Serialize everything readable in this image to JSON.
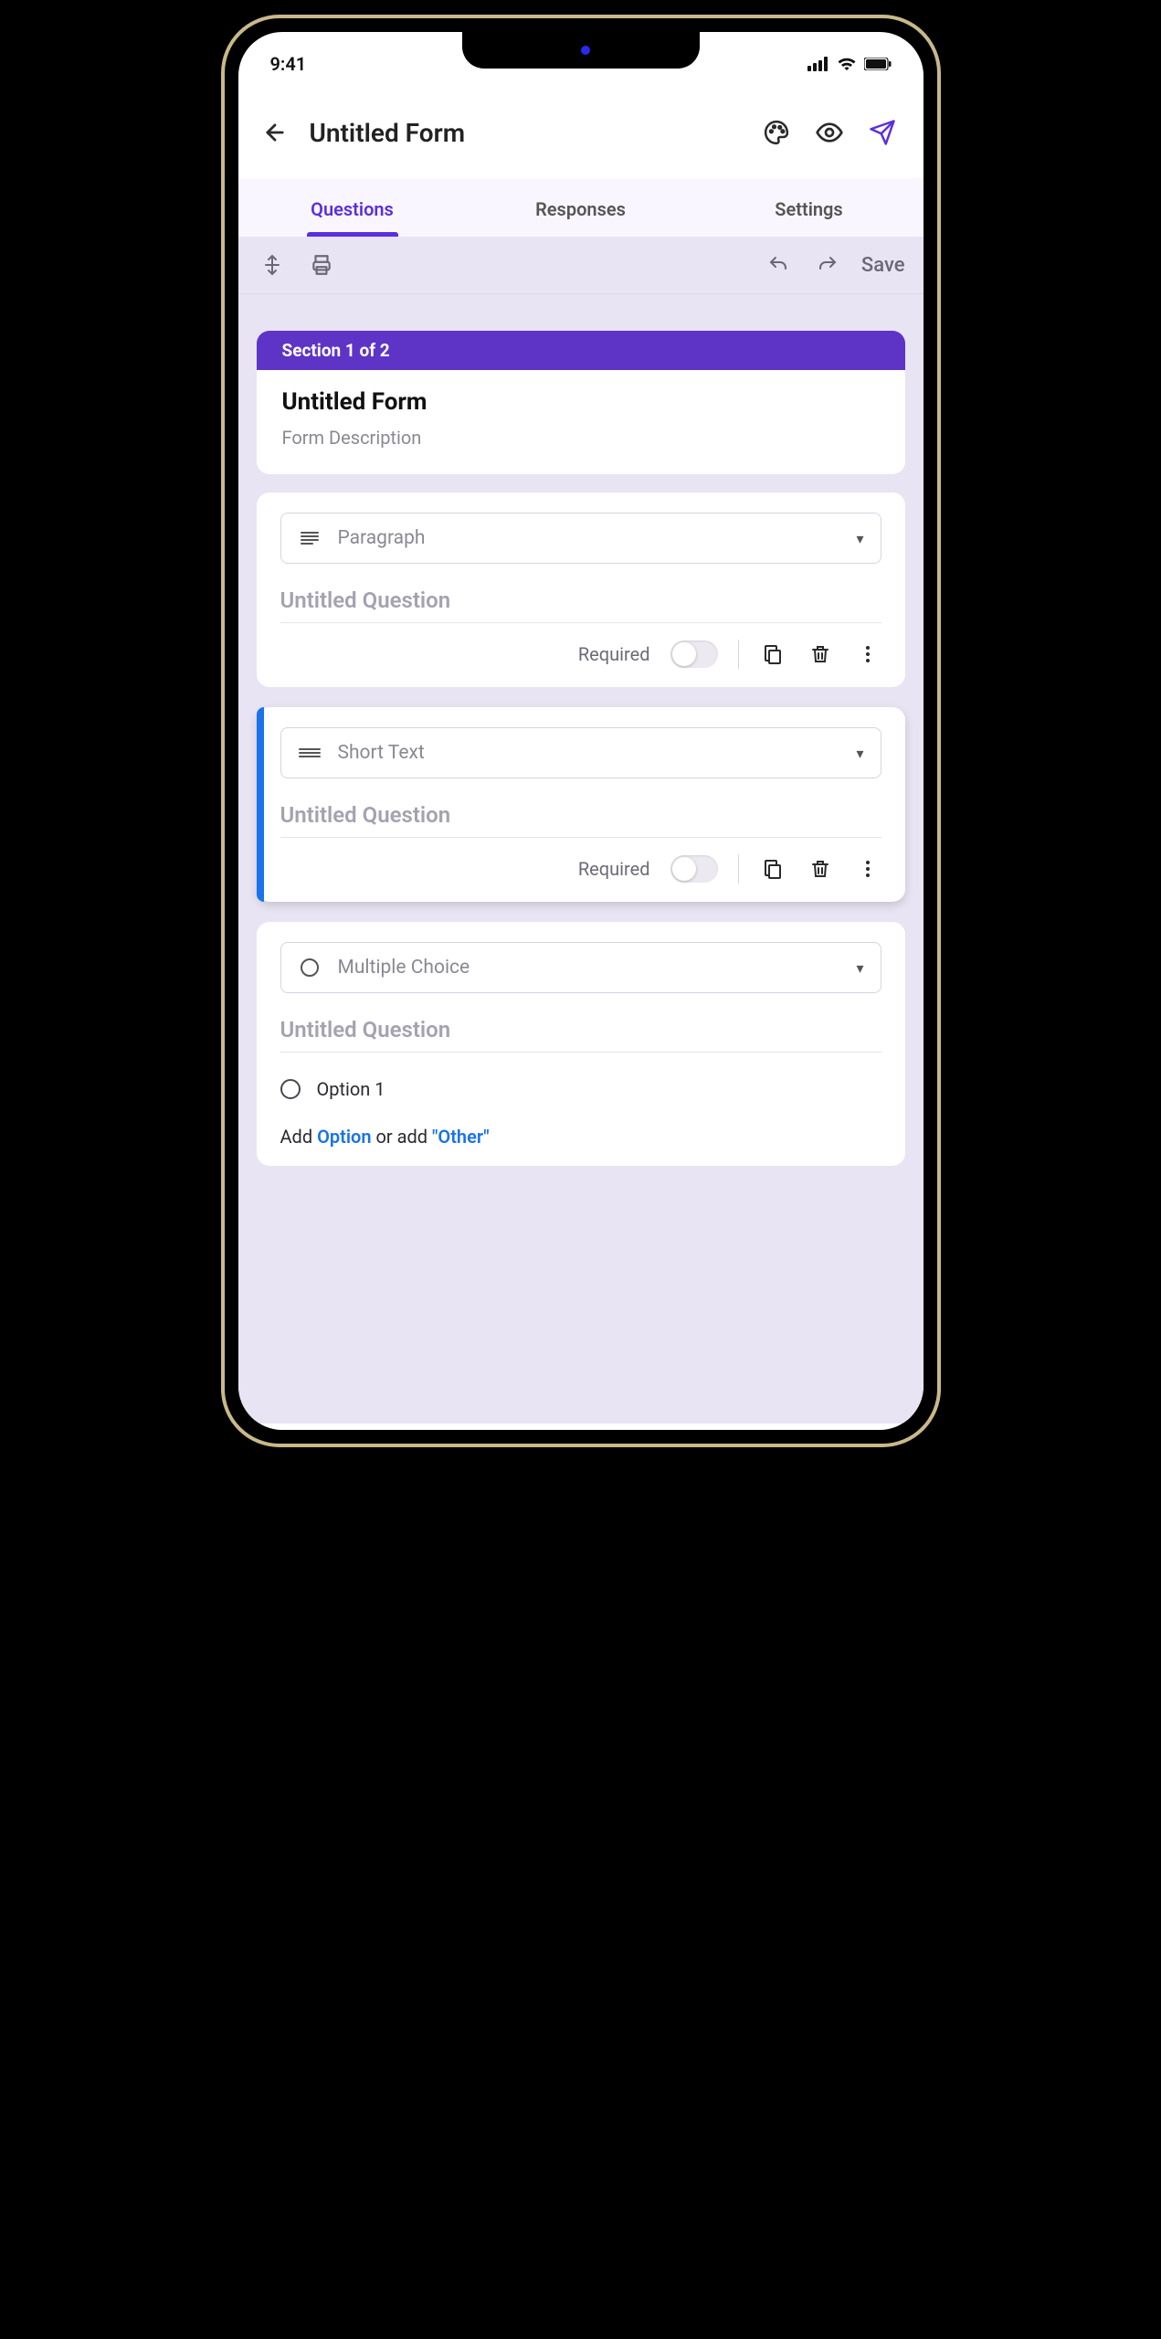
{
  "status": {
    "time": "9:41"
  },
  "header": {
    "title": "Untitled Form"
  },
  "tabs": {
    "questions": "Questions",
    "responses": "Responses",
    "settings": "Settings"
  },
  "toolbar": {
    "save": "Save"
  },
  "section": {
    "label": "Section 1 of 2"
  },
  "form": {
    "title": "Untitled Form",
    "description": "Form Description"
  },
  "questions": [
    {
      "type": "Paragraph",
      "title": "Untitled Question",
      "required_label": "Required"
    },
    {
      "type": "Short Text",
      "title": "Untitled Question",
      "required_label": "Required"
    },
    {
      "type": "Multiple Choice",
      "title": "Untitled Question",
      "options": [
        "Option 1"
      ],
      "add_text_pre": "Add ",
      "add_option": "Option",
      "add_mid": " or add ",
      "add_other": "\"Other\""
    }
  ]
}
